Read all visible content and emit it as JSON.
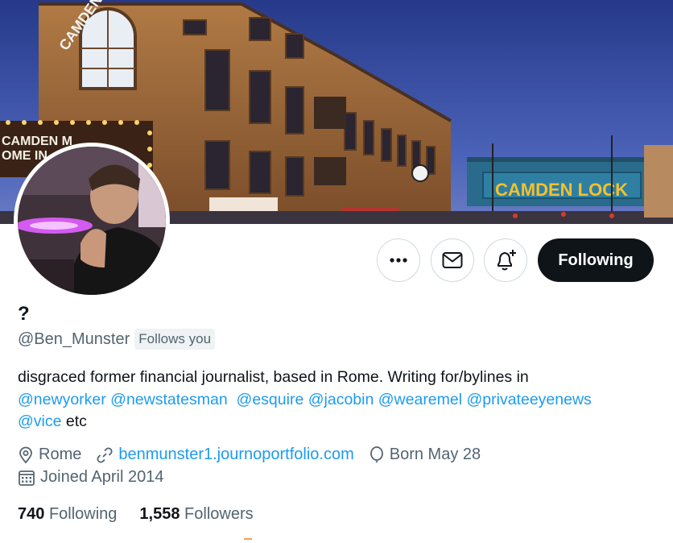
{
  "banner": {
    "sign_left_line1": "CAMDEN M",
    "sign_left_line2": "OME IN",
    "sign_arch": "CAMDEN LOCK",
    "sign_bridge": "CAMDEN LOCK"
  },
  "actions": {
    "more_icon": "more-icon",
    "message_icon": "envelope-icon",
    "notify_icon": "bell-plus-icon",
    "follow_label": "Following"
  },
  "profile": {
    "display_name": "?",
    "handle": "@Ben_Munster",
    "follows_badge": "Follows you",
    "bio": {
      "text1": "disgraced former financial journalist, based in Rome. Writing for/bylines in",
      "mentions": [
        "@newyorker",
        "@newstatesman",
        "@esquire",
        "@jacobin",
        "@wearemel",
        "@privateeyenews",
        "@vice"
      ],
      "tail": "etc"
    },
    "location": "Rome",
    "website": "benmunster1.journoportfolio.com",
    "birthday": "Born May 28",
    "joined": "Joined April 2014"
  },
  "stats": {
    "following_count": "740",
    "following_label": "Following",
    "followers_count": "1,558",
    "followers_label": "Followers"
  },
  "colors": {
    "accent": "#1d9bf0",
    "text_primary": "#0f1419",
    "text_secondary": "#536471",
    "follow_button": "#0f1419"
  }
}
